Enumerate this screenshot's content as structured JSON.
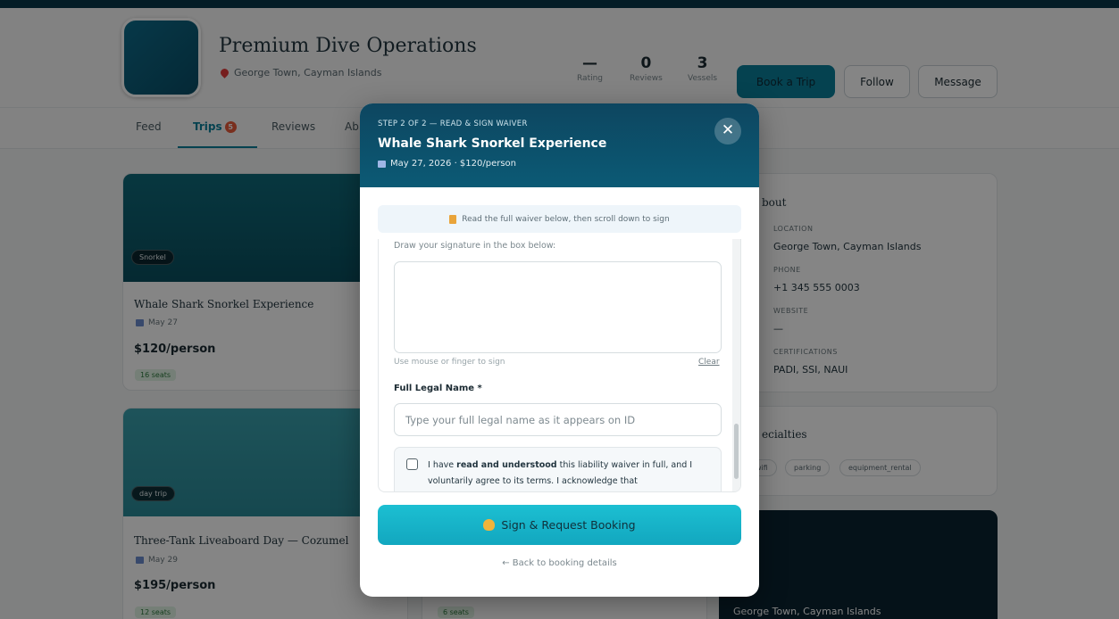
{
  "operator": {
    "name": "Premium Dive Operations",
    "location": "George Town, Cayman Islands"
  },
  "stats": [
    {
      "value": "—",
      "label": "Rating"
    },
    {
      "value": "0",
      "label": "Reviews"
    },
    {
      "value": "3",
      "label": "Vessels"
    }
  ],
  "header_buttons": {
    "book": "Book a Trip",
    "follow": "Follow",
    "message": "Message"
  },
  "tabs": [
    {
      "label": "Feed"
    },
    {
      "label": "Trips",
      "badge": "5"
    },
    {
      "label": "Reviews"
    },
    {
      "label": "Ab"
    }
  ],
  "trips": [
    {
      "chip": "Snorkel",
      "title": "Whale Shark Snorkel Experience",
      "date": "May 27",
      "price": "$120/person",
      "seats": "16 seats",
      "hero_text": "Snorkel"
    },
    {
      "chip": "day trip",
      "title": "Three-Tank Liveaboard Day — Cozumel",
      "date": "May 29",
      "price": "$195/person",
      "seats": "12 seats"
    },
    {
      "seats": "6 seats"
    }
  ],
  "sidebar": {
    "about_title": "bout",
    "location_label": "LOCATION",
    "location": "George Town, Cayman Islands",
    "phone_label": "PHONE",
    "phone": "+1 345 555 0003",
    "website_label": "WEBSITE",
    "website": "—",
    "cert_label": "CERTIFICATIONS",
    "certs": "PADI, SSI, NAUI",
    "specialties_title": "ecialties",
    "specialties": [
      "wifi",
      "parking",
      "equipment_rental"
    ],
    "map_caption": "George Town, Cayman Islands"
  },
  "modal": {
    "step": "STEP 2 OF 2 — READ & SIGN WAIVER",
    "title": "Whale Shark Snorkel Experience",
    "subtitle": "May 27, 2026 · $120/person",
    "notice": "Read the full waiver below, then scroll down to sign",
    "sig_label": "Draw your signature in the box below:",
    "sig_hint": "Use mouse or finger to sign",
    "sig_clear": "Clear",
    "name_label": "Full Legal Name *",
    "name_placeholder": "Type your full legal name as it appears on ID",
    "agree_pre": "I have ",
    "agree_bold": "read and understood",
    "agree_post": " this liability waiver in full, and I voluntarily agree to its terms. I acknowledge that",
    "sign_button": "Sign & Request Booking",
    "back_link": "← Back to booking details"
  },
  "colors": {
    "accent": "#0b7f9a",
    "header": "#0d4660",
    "button": "#1cbfd2"
  }
}
